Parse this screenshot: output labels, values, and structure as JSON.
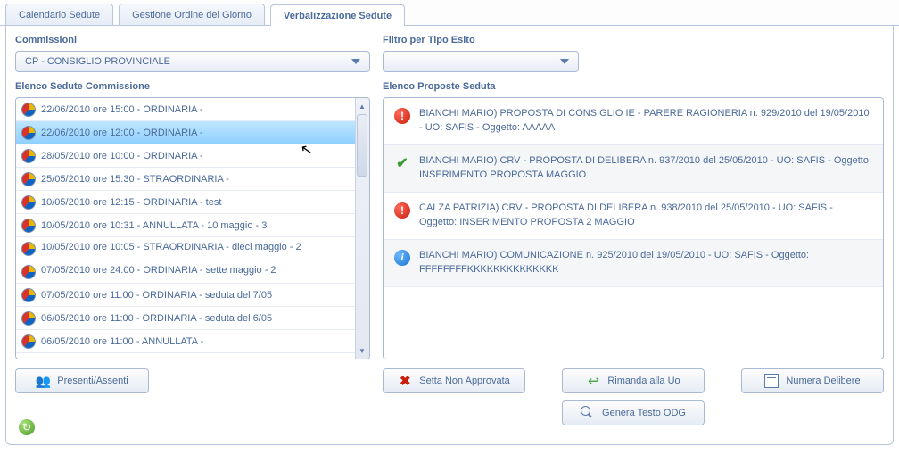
{
  "tabs": [
    {
      "label": "Calendario Sedute",
      "active": false
    },
    {
      "label": "Gestione Ordine del Giorno",
      "active": false
    },
    {
      "label": "Verbalizzazione Sedute",
      "active": true
    }
  ],
  "left": {
    "commissioni_label": "Commissioni",
    "commissioni_value": "CP - CONSIGLIO PROVINCIALE",
    "elenco_label": "Elenco Sedute Commissione",
    "items": [
      {
        "text": "22/06/2010 ore 15:00 - ORDINARIA -",
        "selected": false
      },
      {
        "text": "22/06/2010 ore 12:00 - ORDINARIA -",
        "selected": true
      },
      {
        "text": "28/05/2010 ore 10:00 - ORDINARIA -",
        "selected": false
      },
      {
        "text": "25/05/2010 ore 15:30 - STRAORDINARIA -",
        "selected": false
      },
      {
        "text": "10/05/2010 ore 12:15 - ORDINARIA - test",
        "selected": false
      },
      {
        "text": "10/05/2010 ore 10:31 - ANNULLATA - 10 maggio - 3",
        "selected": false
      },
      {
        "text": "10/05/2010 ore 10:05 - STRAORDINARIA - dieci maggio - 2",
        "selected": false
      },
      {
        "text": "07/05/2010 ore 24:00 - ORDINARIA - sette maggio - 2",
        "selected": false
      },
      {
        "text": "07/05/2010 ore 11:00 - ORDINARIA - seduta del 7/05",
        "selected": false
      },
      {
        "text": "06/05/2010 ore 11:00 - ORDINARIA - seduta del 6/05",
        "selected": false
      },
      {
        "text": "06/05/2010 ore 11:00 - ANNULLATA -",
        "selected": false
      }
    ],
    "presenti_btn": "Presenti/Assenti"
  },
  "right": {
    "filtro_label": "Filtro per Tipo Esito",
    "filtro_value": "",
    "elenco_label": "Elenco Proposte Seduta",
    "proposals": [
      {
        "status": "warn",
        "text": "BIANCHI MARIO) PROPOSTA DI CONSIGLIO IE - PARERE RAGIONERIA n. 929/2010 del 19/05/2010 - UO: SAFIS - Oggetto: AAAAA"
      },
      {
        "status": "ok",
        "text": "BIANCHI MARIO) CRV - PROPOSTA DI DELIBERA n. 937/2010 del 25/05/2010 - UO: SAFIS - Oggetto: INSERIMENTO PROPOSTA MAGGIO"
      },
      {
        "status": "warn",
        "text": "CALZA PATRIZIA) CRV - PROPOSTA DI DELIBERA n. 938/2010 del 25/05/2010 - UO: SAFIS - Oggetto: INSERIMENTO PROPOSTA 2 MAGGIO"
      },
      {
        "status": "info",
        "text": "BIANCHI MARIO) COMUNICAZIONE n. 925/2010 del 19/05/2010 - UO: SAFIS - Oggetto: FFFFFFFFKKKKKKKKKKKKKK"
      }
    ],
    "buttons": {
      "non_approvata": "Setta Non Approvata",
      "rimanda": "Rimanda alla Uo",
      "numera": "Numera Delibere",
      "genera": "Genera Testo ODG"
    }
  }
}
